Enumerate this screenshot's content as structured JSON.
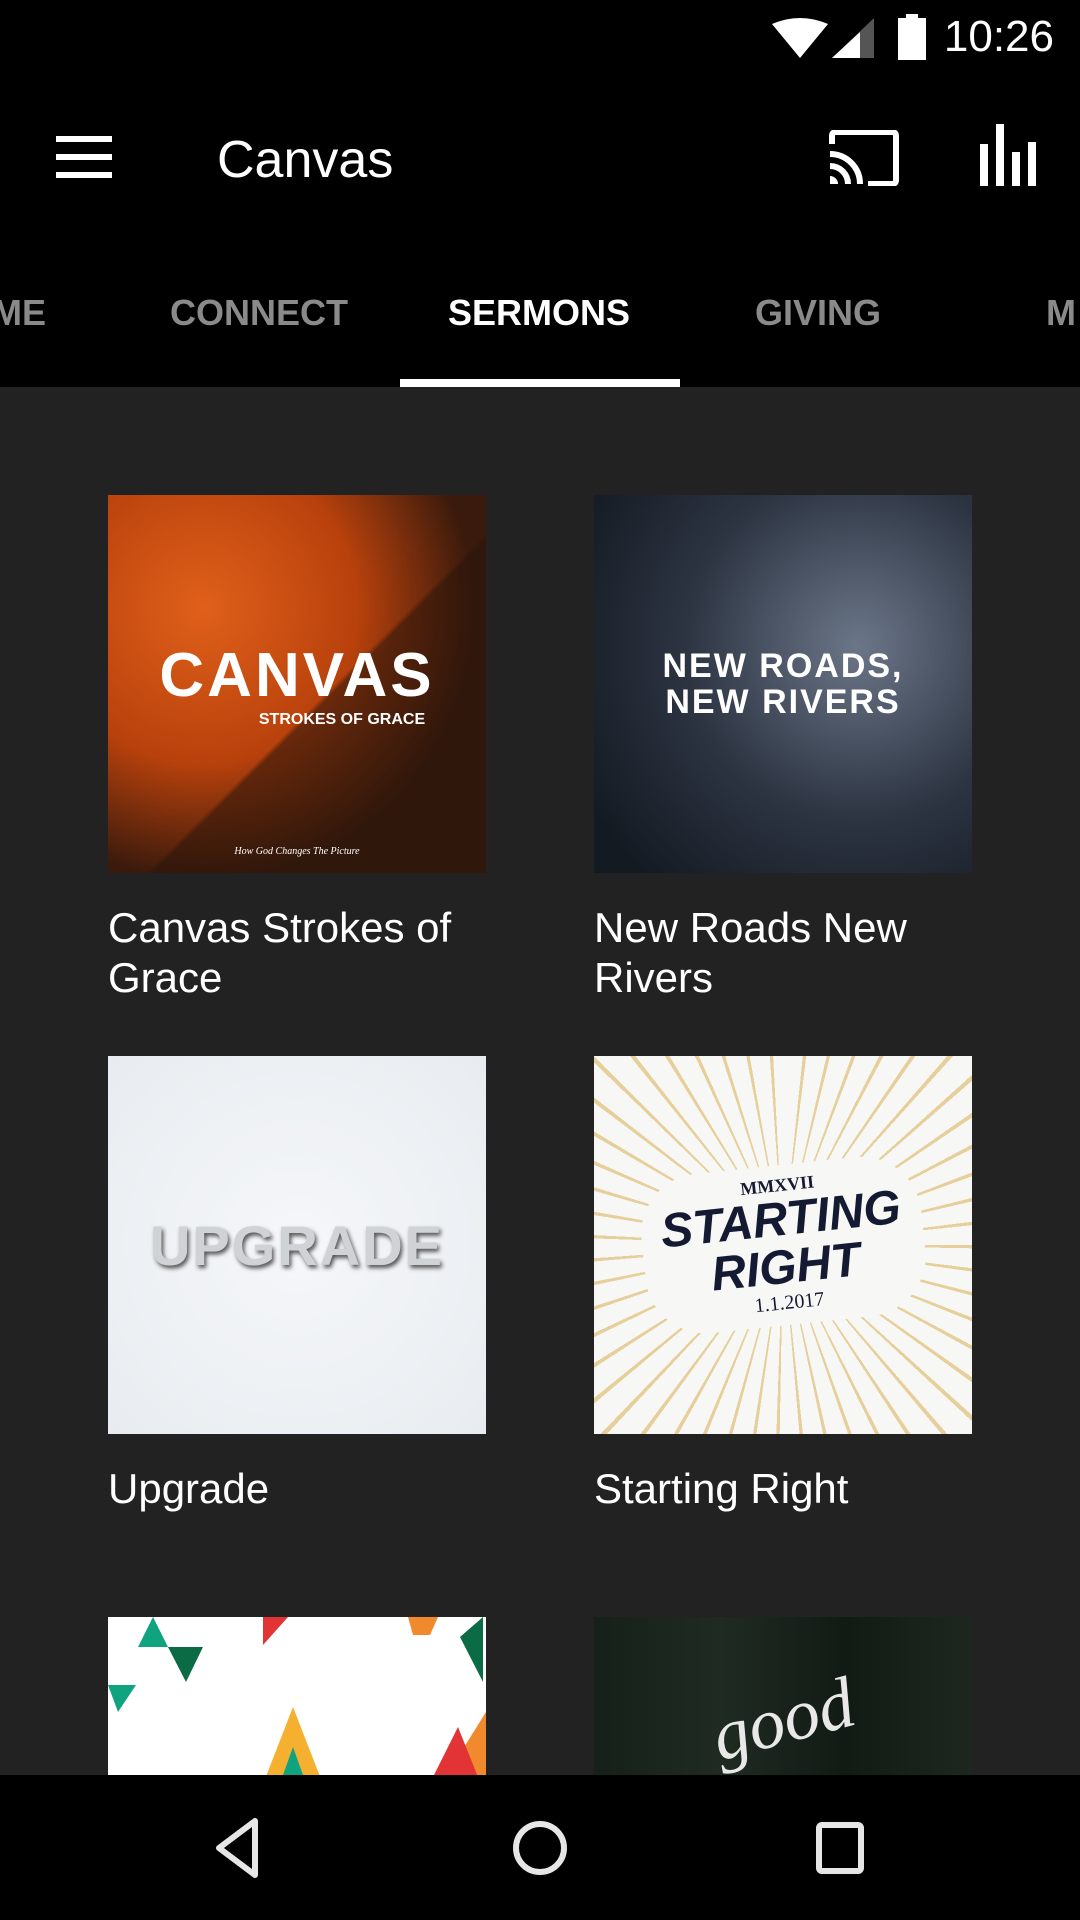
{
  "status_bar": {
    "time": "10:26",
    "icons": [
      "wifi-icon",
      "cellular-signal-icon",
      "battery-icon"
    ]
  },
  "toolbar": {
    "title": "Canvas",
    "icons": [
      "menu-icon",
      "cast-icon",
      "equalizer-icon"
    ]
  },
  "tabs": [
    {
      "label": "ME",
      "active": false
    },
    {
      "label": "CONNECT",
      "active": false
    },
    {
      "label": "SERMONS",
      "active": true
    },
    {
      "label": "GIVING",
      "active": false
    },
    {
      "label": "M",
      "active": false
    }
  ],
  "sermons": [
    {
      "title": "Canvas Strokes of Grace",
      "art_text": [
        "CANVAS",
        "STROKES OF GRACE",
        "How God Changes The Picture"
      ]
    },
    {
      "title": "New Roads New Rivers",
      "art_text": [
        "NEW ROADS,",
        "NEW RIVERS"
      ]
    },
    {
      "title": "Upgrade",
      "art_text": [
        "UPGRADE"
      ]
    },
    {
      "title": "Starting Right",
      "art_text": [
        "MMXVII",
        "STARTING",
        "RIGHT",
        "1.1.2017"
      ]
    },
    {
      "title": "",
      "art_text": []
    },
    {
      "title": "",
      "art_text": [
        "good"
      ]
    }
  ],
  "nav_bar": {
    "icons": [
      "back-icon",
      "home-icon",
      "recents-icon"
    ]
  },
  "colors": {
    "background": "#000000",
    "content": "#222222",
    "tab_inactive": "#8a8a8a",
    "accent": "#ffffff"
  }
}
